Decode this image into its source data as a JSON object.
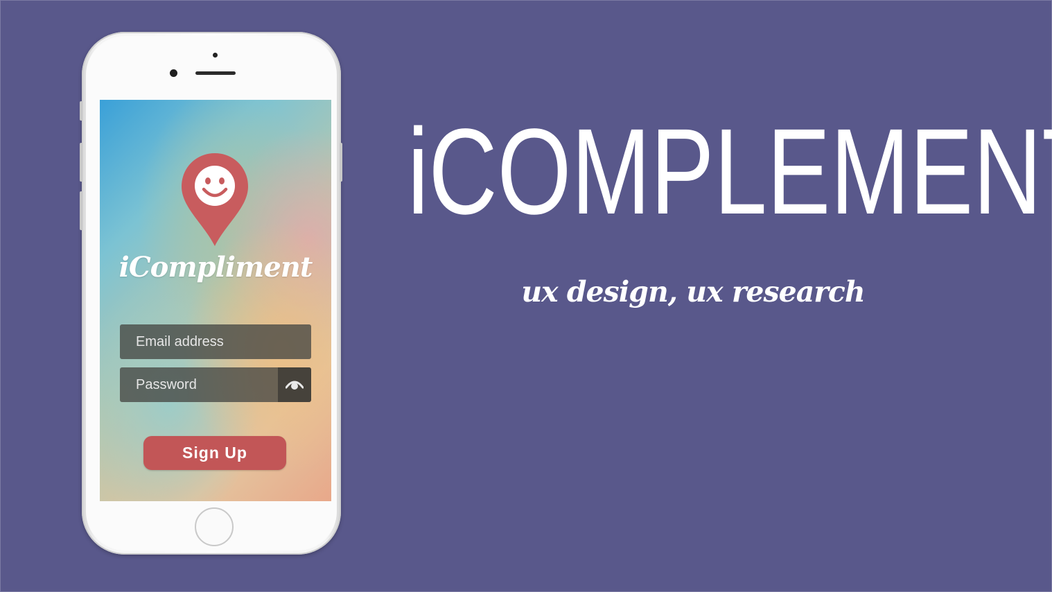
{
  "slide": {
    "title": "iCOMPLEMENT",
    "subtitle": "ux design, ux research",
    "background_color": "#59588b"
  },
  "phone_app": {
    "app_name": "iCompliment",
    "logo_icon": "map-pin-smiley-icon",
    "email_placeholder": "Email address",
    "password_placeholder": "Password",
    "show_password_icon": "eye-icon",
    "signup_label": "Sign Up",
    "accent_color": "#c25657"
  }
}
